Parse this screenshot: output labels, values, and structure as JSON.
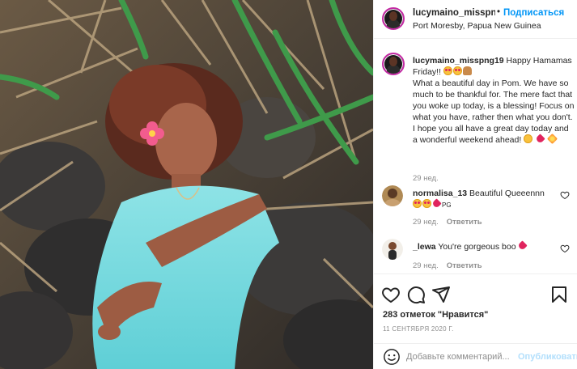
{
  "header": {
    "username": "lucymaino_misspng",
    "separator": "•",
    "follow_label": "Подписаться",
    "location": "Port Moresby, Papua New Guinea"
  },
  "caption": {
    "username": "lucymaino_misspng19",
    "text_line1": " Happy Hamamas Friday!! ",
    "text_body": "What a beautiful day in Pom. We have so much to be thankful for. The mere fact that you woke up today, is a blessing! Focus on what you have, rather then what you don't. I hope you all have a great day today and a wonderful weekend ahead! ",
    "time": "29 нед."
  },
  "comments": [
    {
      "username": "normalisa_13",
      "text": " Beautiful Queeennn",
      "suffix": "PG",
      "time": "29 нед.",
      "reply_label": "Ответить"
    },
    {
      "username": "_lewa",
      "text": " You're gorgeous boo ",
      "time": "29 нед.",
      "reply_label": "Ответить"
    }
  ],
  "actions": {
    "likes": "283 отметок \"Нравится\"",
    "date": "11 СЕНТЯБРЯ 2020 Г."
  },
  "add_comment": {
    "placeholder": "Добавьте комментарий...",
    "publish_label": "Опубликовать"
  },
  "icons": {
    "like": "heart-outline-icon",
    "comment": "speech-bubble-icon",
    "share": "paper-plane-icon",
    "save": "bookmark-icon",
    "emoji": "smiley-icon"
  },
  "colors": {
    "accent": "#0095f6",
    "publish_disabled": "#b2dffc",
    "muted": "#8e8e8e",
    "text": "#262626",
    "heart": "#ed4956"
  }
}
